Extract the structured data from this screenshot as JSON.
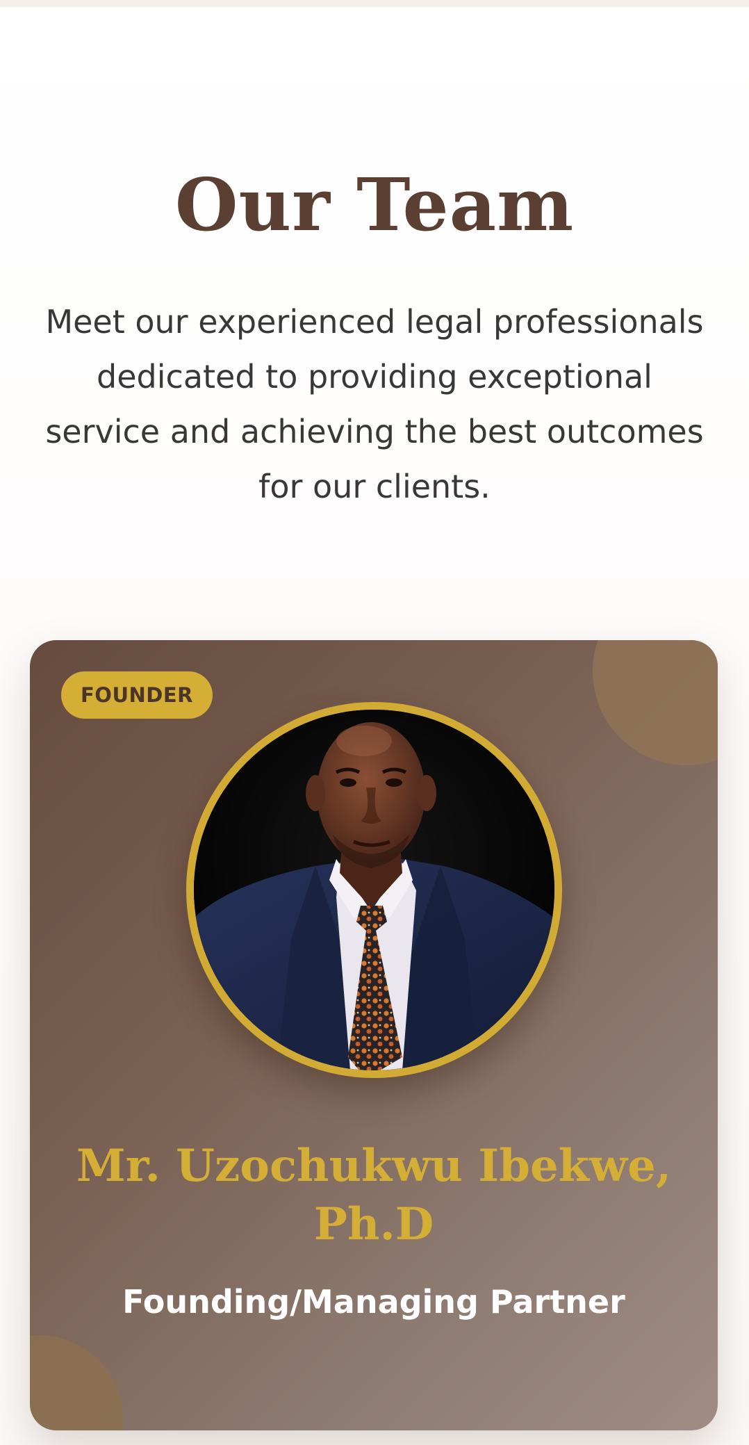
{
  "team_section": {
    "title": "Our Team",
    "description": "Meet our experienced legal professionals dedicated to providing exceptional service and achieving the best outcomes for our clients."
  },
  "member_card": {
    "badge": "FOUNDER",
    "photo_icon": "portrait-photo",
    "name": "Mr. Uzochukwu Ibekwe, Ph.D",
    "role": "Founding/Managing Partner"
  },
  "colors": {
    "heading": "#5b3f33",
    "accent_gold": "#d4ae35",
    "card_brown": "#6e5447",
    "body_text": "#383838"
  }
}
